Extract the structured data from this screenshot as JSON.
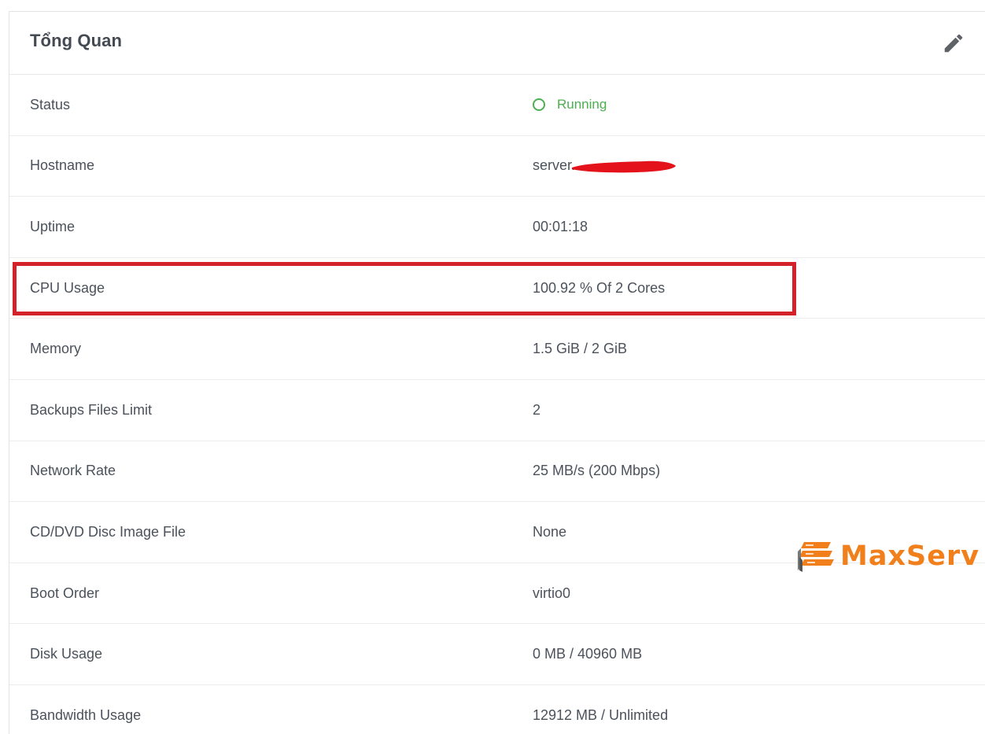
{
  "panel": {
    "title": "Tổng Quan",
    "edit_icon": "pencil-icon"
  },
  "rows": [
    {
      "label": "Status",
      "value": "Running",
      "status_color": "#4caf50"
    },
    {
      "label": "Hostname",
      "value": "server.",
      "redacted": true
    },
    {
      "label": "Uptime",
      "value": "00:01:18"
    },
    {
      "label": "CPU Usage",
      "value": "100.92 % Of 2 Cores",
      "highlighted": true
    },
    {
      "label": "Memory",
      "value": "1.5 GiB / 2 GiB"
    },
    {
      "label": "Backups Files Limit",
      "value": "2"
    },
    {
      "label": "Network Rate",
      "value": "25 MB/s (200 Mbps)"
    },
    {
      "label": "CD/DVD Disc Image File",
      "value": "None"
    },
    {
      "label": "Boot Order",
      "value": "virtio0"
    },
    {
      "label": "Disk Usage",
      "value": "0 MB / 40960 MB"
    },
    {
      "label": "Bandwidth Usage",
      "value": "12912 MB / Unlimited"
    }
  ],
  "annotation": {
    "highlight_color": "#d3222a",
    "redaction_color": "#e3121b"
  },
  "watermark": {
    "text": "MaxServ",
    "color": "#f07f1c"
  }
}
